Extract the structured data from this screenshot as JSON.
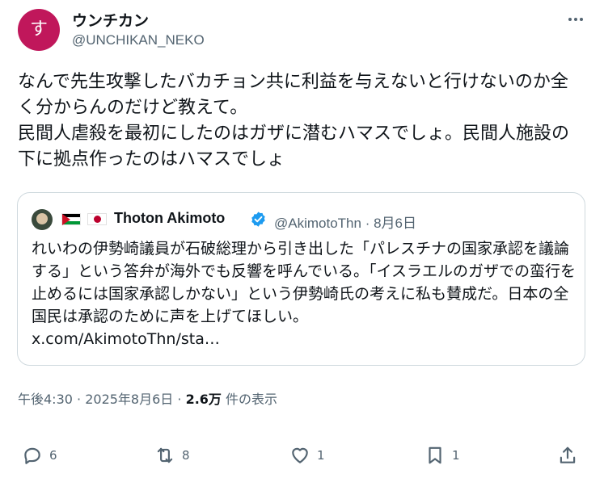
{
  "author": {
    "avatar_glyph": "す",
    "avatar_color": "#c0175b",
    "display_name": "ウンチカン",
    "handle": "@UNCHIKAN_NEKO"
  },
  "post": {
    "text": "なんで先生攻撃したバカチョン共に利益を与えないと行けないのか全く分からんのだけど教えて。\n民間人虐殺を最初にしたのはガザに潜むハマスでしょ。民間人施設の下に拠点作ったのはハマスでしょ",
    "time": "午後4:30",
    "date": "2025年8月6日",
    "views_count": "2.6万",
    "views_label": "件の表示"
  },
  "quoted": {
    "display_name": "Thoton Akimoto",
    "handle": "@AkimotoThn",
    "date": "8月6日",
    "text": "れいわの伊勢崎議員が石破総理から引き出した「パレスチナの国家承認を議論する」という答弁が海外でも反響を呼んでいる。「イスラエルのガザでの蛮行を止めるには国家承認しかない」という伊勢崎氏の考えに私も賛成だ。日本の全国民は承認のために声を上げてほしい。",
    "link": "x.com/AkimotoThn/sta…"
  },
  "actions": {
    "replies": "6",
    "reposts": "8",
    "likes": "1",
    "bookmarks": "1"
  },
  "colors": {
    "text": "#0f1419",
    "secondary": "#536471",
    "border": "#cfd9de",
    "verified": "#1d9bf0"
  }
}
